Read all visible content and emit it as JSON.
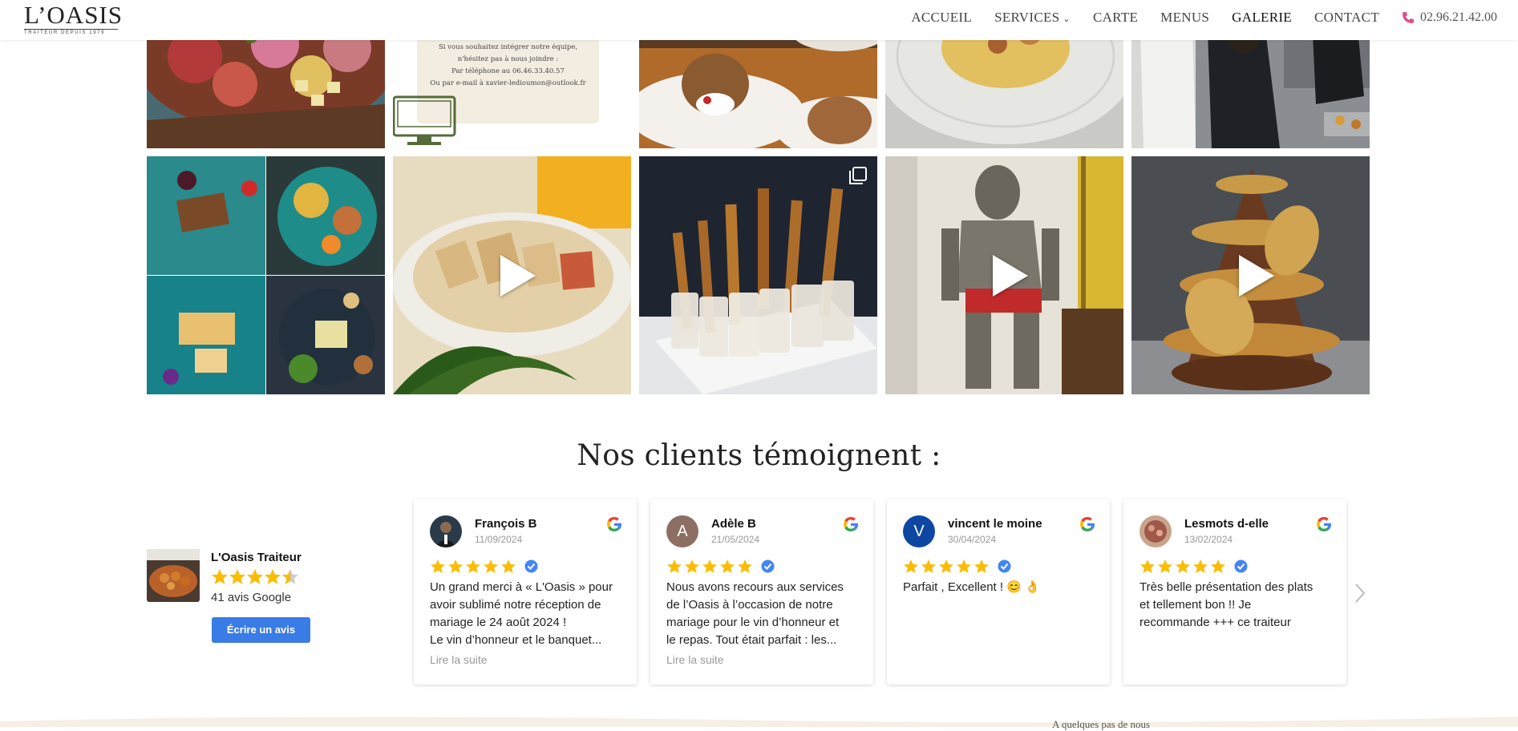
{
  "header": {
    "logo_main": "L’OASIS",
    "logo_sub": "TRAITEUR DEPUIS 1979",
    "nav": [
      {
        "label": "ACCUEIL"
      },
      {
        "label": "SERVICES"
      },
      {
        "label": "CARTE"
      },
      {
        "label": "MENUS"
      },
      {
        "label": "GALERIE",
        "active": true
      },
      {
        "label": "CONTACT"
      }
    ],
    "phone": "02.96.21.42.00",
    "phone_icon": "phone-icon",
    "accent_color": "#e0508a"
  },
  "gallery": {
    "recruit_text": [
      "Si vous souhaitez intégrer notre équipe,",
      "n'hésitez pas à nous joindre :",
      "Par téléphone au 06.46.33.40.57",
      "Ou par e-mail à xavier-ledioumon@outlook.fr"
    ],
    "tiles": [
      {
        "name": "charcuterie-board",
        "video": false
      },
      {
        "name": "recruitment-flyer",
        "video": false
      },
      {
        "name": "dessert-plates",
        "video": false
      },
      {
        "name": "plated-dish",
        "video": false
      },
      {
        "name": "kitchen-staff",
        "video": false
      },
      {
        "name": "dish-collage",
        "video": false
      },
      {
        "name": "sandwich-platter",
        "video": true
      },
      {
        "name": "verrines-breadsticks",
        "video": false,
        "multi": true
      },
      {
        "name": "knight-armor",
        "video": true
      },
      {
        "name": "croquembouche",
        "video": true
      }
    ]
  },
  "testimonials": {
    "title": "Nos clients témoignent :",
    "summary": {
      "name": "L'Oasis Traiteur",
      "rating": 4.5,
      "count_label": "41 avis Google",
      "button": "Écrire un avis"
    },
    "reviews": [
      {
        "author": "François B",
        "date": "11/09/2024",
        "stars": 5,
        "avatar": "photo",
        "lines": [
          "Un grand merci à « L'Oasis » pour",
          "avoir sublimé notre réception de",
          "mariage le 24 août 2024 !",
          "Le vin d’honneur et le banquet..."
        ],
        "read_more": "Lire la suite"
      },
      {
        "author": "Adèle B",
        "date": "21/05/2024",
        "stars": 5,
        "avatar": "A",
        "lines": [
          "Nous avons recours aux services",
          "de l’Oasis à l’occasion de notre",
          "mariage pour le vin d’honneur et",
          "le repas. Tout était parfait : les..."
        ],
        "read_more": "Lire la suite"
      },
      {
        "author": "vincent le moine",
        "date": "30/04/2024",
        "stars": 5,
        "avatar": "V",
        "lines": [
          "Parfait , Excellent ! 😊 👌"
        ],
        "read_more": ""
      },
      {
        "author": "Lesmots d-elle",
        "date": "13/02/2024",
        "stars": 5,
        "avatar": "photo",
        "lines": [
          "Très belle présentation des plats",
          "et tellement bon !! Je",
          "recommande +++ ce traiteur"
        ],
        "read_more": ""
      }
    ],
    "star_color": "#fbbc04",
    "button_color": "#3a7ce6"
  },
  "footer": {
    "partial_text": "A quelques pas de nous"
  }
}
